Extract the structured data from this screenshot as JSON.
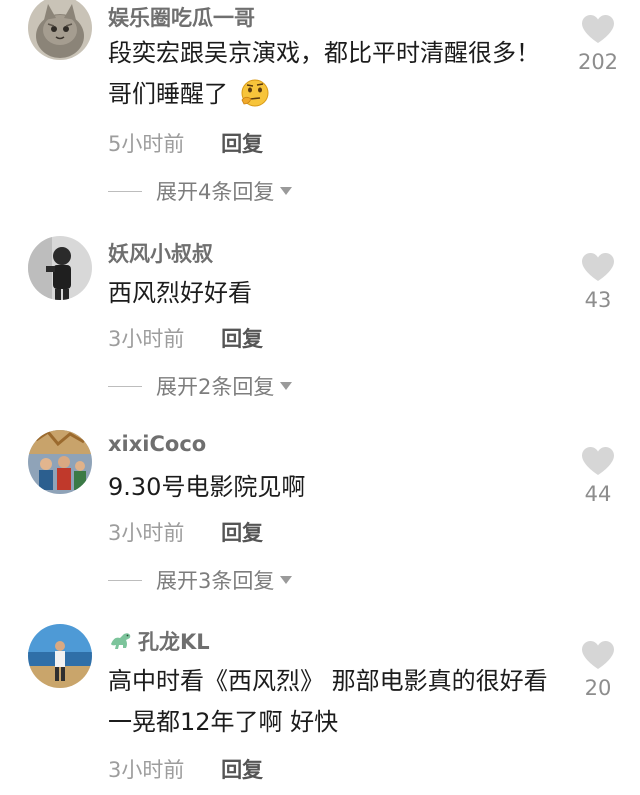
{
  "comments": [
    {
      "username": "娱乐圈吃瓜一哥",
      "text": "段奕宏跟吴京演戏，都比平时清醒很多！哥们睡醒了",
      "emoji": "thinking-face-emoji",
      "time": "5小时前",
      "reply_label": "回复",
      "likes": "202",
      "expand_label": "展开4条回复"
    },
    {
      "username": "妖风小叔叔",
      "text": "西风烈好好看",
      "time": "3小时前",
      "reply_label": "回复",
      "likes": "43",
      "expand_label": "展开2条回复"
    },
    {
      "username": "xixiCoco",
      "text": "9.30号电影院见啊",
      "time": "3小时前",
      "reply_label": "回复",
      "likes": "44",
      "expand_label": "展开3条回复"
    },
    {
      "username": "孔龙KL",
      "badge": "dinosaur-badge-icon",
      "text": "高中时看《西风烈》 那部电影真的很好看 一晃都12年了啊 好快",
      "time": "3小时前",
      "reply_label": "回复",
      "likes": "20"
    }
  ],
  "colors": {
    "username": "#6f6f6f",
    "text": "#1c1c1c",
    "meta": "#9d9d9d",
    "heart": "#d6d6d6"
  }
}
